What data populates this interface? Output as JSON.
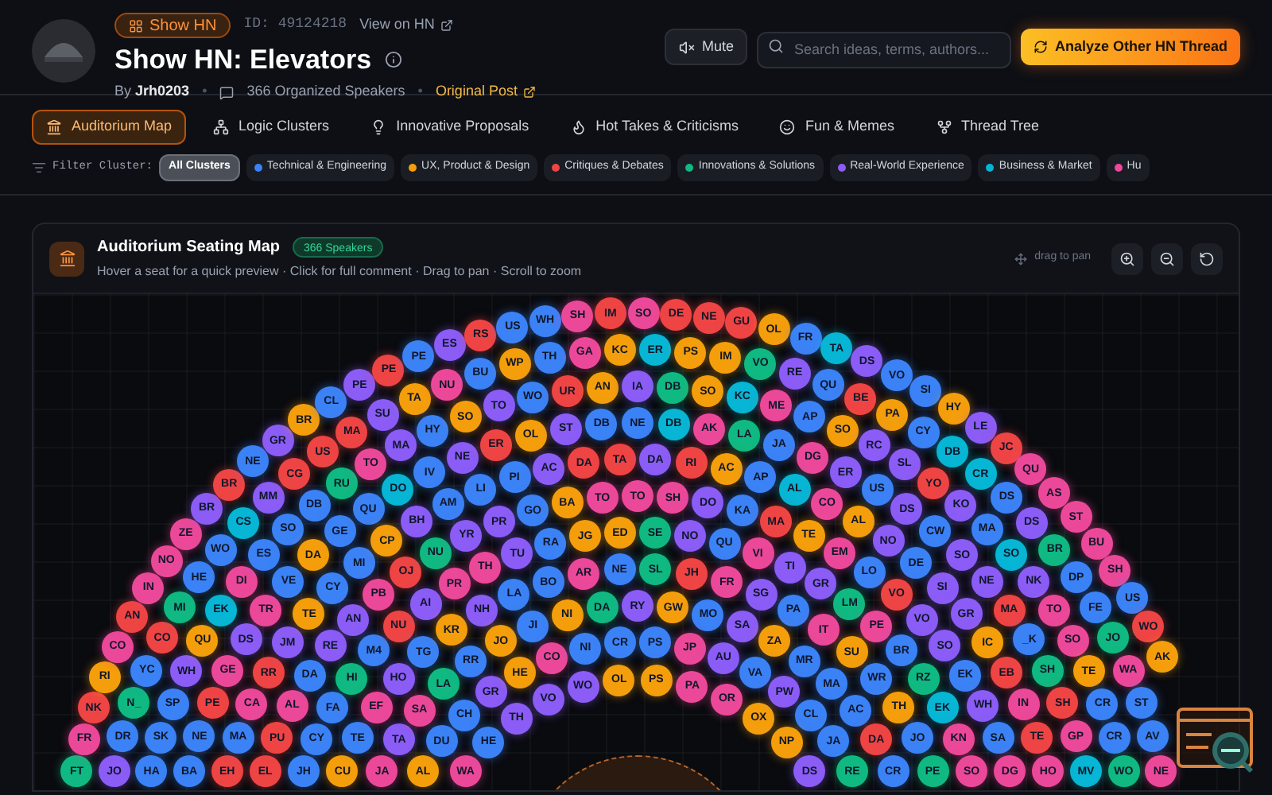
{
  "header": {
    "badge": "Show HN",
    "id": "ID: 49124218",
    "view_link": "View on HN",
    "title": "Show HN: Elevators",
    "by": "By",
    "author": "Jrh0203",
    "speakers": "366 Organized Speakers",
    "original_post": "Original Post",
    "separators": [
      "•",
      "•"
    ]
  },
  "mute_button": "Mute",
  "search": {
    "placeholder": "Search ideas, terms, authors..."
  },
  "analyze_button": "Analyze Other HN Thread",
  "tabs": [
    {
      "label": "Auditorium Map",
      "kind": "map",
      "selected": true
    },
    {
      "label": "Logic Clusters",
      "kind": "clusters",
      "selected": false
    },
    {
      "label": "Innovative Proposals",
      "kind": "ideas",
      "selected": false
    },
    {
      "label": "Hot Takes & Criticisms",
      "kind": "hot",
      "selected": false
    },
    {
      "label": "Fun & Memes",
      "kind": "fun",
      "selected": false
    },
    {
      "label": "Thread Tree",
      "kind": "tree",
      "selected": false
    }
  ],
  "filter": {
    "label": "Filter Cluster:",
    "chips": [
      {
        "label": "All Clusters",
        "selected": true
      },
      {
        "label": "Technical & Engineering",
        "color": "#3b82f6",
        "selected": false
      },
      {
        "label": "UX, Product & Design",
        "color": "#f59e0b",
        "selected": false
      },
      {
        "label": "Critiques & Debates",
        "color": "#ef4444",
        "selected": false
      },
      {
        "label": "Innovations & Solutions",
        "color": "#10b981",
        "selected": false
      },
      {
        "label": "Real-World Experience",
        "color": "#8b5cf6",
        "selected": false
      },
      {
        "label": "Business & Market",
        "color": "#06b6d4",
        "selected": false
      },
      {
        "label": "Hu",
        "color": "#ec4899",
        "selected": false
      }
    ]
  },
  "map": {
    "title": "Auditorium Seating Map",
    "badge": "366 Speakers",
    "subtitle": "Hover a seat for a quick preview · Click for full comment · Drag to pan · Scroll to zoom",
    "pan_hint": "drag to pan",
    "rings": [
      {
        "seats": [
          {
            "label": "FT",
            "color": "#10b981"
          },
          {
            "label": "FR",
            "color": "#ec4899"
          },
          {
            "label": "NK",
            "color": "#ef4444"
          },
          {
            "label": "RI",
            "color": "#f59e0b"
          },
          {
            "label": "CO",
            "color": "#ec4899"
          },
          {
            "label": "AN",
            "color": "#ef4444"
          },
          {
            "label": "IN",
            "color": "#ec4899"
          },
          {
            "label": "NO",
            "color": "#ec4899"
          },
          {
            "label": "ZE",
            "color": "#ec4899"
          },
          {
            "label": "BR",
            "color": "#8b5cf6"
          },
          {
            "label": "BR",
            "color": "#ef4444"
          },
          {
            "label": "NE",
            "color": "#3b82f6"
          },
          {
            "label": "GR",
            "color": "#8b5cf6"
          },
          {
            "label": "BR",
            "color": "#f59e0b"
          },
          {
            "label": "CL",
            "color": "#3b82f6"
          },
          {
            "label": "PE",
            "color": "#8b5cf6"
          },
          {
            "label": "PE",
            "color": "#ef4444"
          },
          {
            "label": "PE",
            "color": "#3b82f6"
          },
          {
            "label": "ES",
            "color": "#8b5cf6"
          },
          {
            "label": "RS",
            "color": "#ef4444"
          },
          {
            "label": "US",
            "color": "#3b82f6"
          },
          {
            "label": "WH",
            "color": "#3b82f6"
          },
          {
            "label": "SH",
            "color": "#ec4899"
          },
          {
            "label": "IM",
            "color": "#ef4444"
          },
          {
            "label": "SO",
            "color": "#ec4899"
          },
          {
            "label": "DE",
            "color": "#ef4444"
          },
          {
            "label": "NE",
            "color": "#ef4444"
          },
          {
            "label": "GU",
            "color": "#ef4444"
          },
          {
            "label": "OL",
            "color": "#f59e0b"
          },
          {
            "label": "FR",
            "color": "#3b82f6"
          },
          {
            "label": "TA",
            "color": "#06b6d4"
          },
          {
            "label": "DS",
            "color": "#8b5cf6"
          },
          {
            "label": "VO",
            "color": "#3b82f6"
          },
          {
            "label": "SI",
            "color": "#3b82f6"
          },
          {
            "label": "HY",
            "color": "#f59e0b"
          },
          {
            "label": "LE",
            "color": "#8b5cf6"
          },
          {
            "label": "JC",
            "color": "#ef4444"
          },
          {
            "label": "QU",
            "color": "#ec4899"
          },
          {
            "label": "AS",
            "color": "#ec4899"
          },
          {
            "label": "ST",
            "color": "#ec4899"
          },
          {
            "label": "BU",
            "color": "#ec4899"
          },
          {
            "label": "SH",
            "color": "#ec4899"
          },
          {
            "label": "US",
            "color": "#3b82f6"
          },
          {
            "label": "WO",
            "color": "#ef4444"
          },
          {
            "label": "AK",
            "color": "#f59e0b"
          }
        ]
      },
      {
        "seats": [
          {
            "label": "JO",
            "color": "#8b5cf6"
          },
          {
            "label": "DR",
            "color": "#3b82f6"
          },
          {
            "label": "N_",
            "color": "#10b981"
          },
          {
            "label": "YC",
            "color": "#3b82f6"
          },
          {
            "label": "CO",
            "color": "#ef4444"
          },
          {
            "label": "MI",
            "color": "#10b981"
          },
          {
            "label": "HE",
            "color": "#3b82f6"
          },
          {
            "label": "WO",
            "color": "#3b82f6"
          },
          {
            "label": "CS",
            "color": "#06b6d4"
          },
          {
            "label": "MM",
            "color": "#8b5cf6"
          },
          {
            "label": "CG",
            "color": "#ef4444"
          },
          {
            "label": "US",
            "color": "#ef4444"
          },
          {
            "label": "MA",
            "color": "#ef4444"
          },
          {
            "label": "SU",
            "color": "#8b5cf6"
          },
          {
            "label": "TA",
            "color": "#f59e0b"
          },
          {
            "label": "NU",
            "color": "#ec4899"
          },
          {
            "label": "BU",
            "color": "#3b82f6"
          },
          {
            "label": "WP",
            "color": "#f59e0b"
          },
          {
            "label": "TH",
            "color": "#3b82f6"
          },
          {
            "label": "GA",
            "color": "#ec4899"
          },
          {
            "label": "KC",
            "color": "#f59e0b"
          },
          {
            "label": "ER",
            "color": "#06b6d4"
          },
          {
            "label": "PS",
            "color": "#f59e0b"
          },
          {
            "label": "IM",
            "color": "#f59e0b"
          },
          {
            "label": "VO",
            "color": "#10b981"
          },
          {
            "label": "RE",
            "color": "#8b5cf6"
          },
          {
            "label": "QU",
            "color": "#3b82f6"
          },
          {
            "label": "BE",
            "color": "#ef4444"
          },
          {
            "label": "PA",
            "color": "#f59e0b"
          },
          {
            "label": "CY",
            "color": "#3b82f6"
          },
          {
            "label": "DB",
            "color": "#06b6d4"
          },
          {
            "label": "CR",
            "color": "#06b6d4"
          },
          {
            "label": "DS",
            "color": "#3b82f6"
          },
          {
            "label": "DS",
            "color": "#8b5cf6"
          },
          {
            "label": "BR",
            "color": "#10b981"
          },
          {
            "label": "DP",
            "color": "#3b82f6"
          },
          {
            "label": "FE",
            "color": "#3b82f6"
          },
          {
            "label": "JO",
            "color": "#10b981"
          },
          {
            "label": "WA",
            "color": "#ec4899"
          },
          {
            "label": "ST",
            "color": "#3b82f6"
          },
          {
            "label": "AV",
            "color": "#3b82f6"
          },
          {
            "label": "NE",
            "color": "#ec4899"
          }
        ]
      },
      {
        "seats": [
          {
            "label": "HA",
            "color": "#3b82f6"
          },
          {
            "label": "SK",
            "color": "#3b82f6"
          },
          {
            "label": "SP",
            "color": "#3b82f6"
          },
          {
            "label": "WH",
            "color": "#8b5cf6"
          },
          {
            "label": "QU",
            "color": "#f59e0b"
          },
          {
            "label": "EK",
            "color": "#06b6d4"
          },
          {
            "label": "DI",
            "color": "#ec4899"
          },
          {
            "label": "ES",
            "color": "#3b82f6"
          },
          {
            "label": "SO",
            "color": "#3b82f6"
          },
          {
            "label": "DB",
            "color": "#3b82f6"
          },
          {
            "label": "RU",
            "color": "#10b981"
          },
          {
            "label": "TO",
            "color": "#ec4899"
          },
          {
            "label": "MA",
            "color": "#8b5cf6"
          },
          {
            "label": "HY",
            "color": "#3b82f6"
          },
          {
            "label": "SO",
            "color": "#f59e0b"
          },
          {
            "label": "TO",
            "color": "#8b5cf6"
          },
          {
            "label": "WO",
            "color": "#3b82f6"
          },
          {
            "label": "UR",
            "color": "#ef4444"
          },
          {
            "label": "AN",
            "color": "#f59e0b"
          },
          {
            "label": "IA",
            "color": "#8b5cf6"
          },
          {
            "label": "DB",
            "color": "#10b981"
          },
          {
            "label": "SO",
            "color": "#f59e0b"
          },
          {
            "label": "KC",
            "color": "#06b6d4"
          },
          {
            "label": "ME",
            "color": "#ec4899"
          },
          {
            "label": "AP",
            "color": "#3b82f6"
          },
          {
            "label": "SO",
            "color": "#f59e0b"
          },
          {
            "label": "RC",
            "color": "#8b5cf6"
          },
          {
            "label": "SL",
            "color": "#8b5cf6"
          },
          {
            "label": "YO",
            "color": "#ef4444"
          },
          {
            "label": "KO",
            "color": "#8b5cf6"
          },
          {
            "label": "MA",
            "color": "#3b82f6"
          },
          {
            "label": "SO",
            "color": "#06b6d4"
          },
          {
            "label": "NK",
            "color": "#8b5cf6"
          },
          {
            "label": "TO",
            "color": "#ec4899"
          },
          {
            "label": "SO",
            "color": "#ec4899"
          },
          {
            "label": "TE",
            "color": "#f59e0b"
          },
          {
            "label": "CR",
            "color": "#3b82f6"
          },
          {
            "label": "CR",
            "color": "#3b82f6"
          },
          {
            "label": "WO",
            "color": "#10b981"
          }
        ]
      },
      {
        "seats": [
          {
            "label": "BA",
            "color": "#3b82f6"
          },
          {
            "label": "NE",
            "color": "#3b82f6"
          },
          {
            "label": "PE",
            "color": "#ef4444"
          },
          {
            "label": "GE",
            "color": "#ec4899"
          },
          {
            "label": "DS",
            "color": "#8b5cf6"
          },
          {
            "label": "TR",
            "color": "#ec4899"
          },
          {
            "label": "VE",
            "color": "#3b82f6"
          },
          {
            "label": "DA",
            "color": "#f59e0b"
          },
          {
            "label": "GE",
            "color": "#3b82f6"
          },
          {
            "label": "QU",
            "color": "#3b82f6"
          },
          {
            "label": "DO",
            "color": "#06b6d4"
          },
          {
            "label": "IV",
            "color": "#3b82f6"
          },
          {
            "label": "NE",
            "color": "#8b5cf6"
          },
          {
            "label": "ER",
            "color": "#ef4444"
          },
          {
            "label": "OL",
            "color": "#f59e0b"
          },
          {
            "label": "ST",
            "color": "#8b5cf6"
          },
          {
            "label": "DB",
            "color": "#3b82f6"
          },
          {
            "label": "NE",
            "color": "#3b82f6"
          },
          {
            "label": "DB",
            "color": "#06b6d4"
          },
          {
            "label": "AK",
            "color": "#ec4899"
          },
          {
            "label": "LA",
            "color": "#10b981"
          },
          {
            "label": "JA",
            "color": "#3b82f6"
          },
          {
            "label": "DG",
            "color": "#ec4899"
          },
          {
            "label": "ER",
            "color": "#8b5cf6"
          },
          {
            "label": "US",
            "color": "#3b82f6"
          },
          {
            "label": "DS",
            "color": "#8b5cf6"
          },
          {
            "label": "CW",
            "color": "#3b82f6"
          },
          {
            "label": "SO",
            "color": "#8b5cf6"
          },
          {
            "label": "NE",
            "color": "#8b5cf6"
          },
          {
            "label": "MA",
            "color": "#ef4444"
          },
          {
            "label": "_K",
            "color": "#3b82f6"
          },
          {
            "label": "SH",
            "color": "#10b981"
          },
          {
            "label": "SH",
            "color": "#ef4444"
          },
          {
            "label": "GP",
            "color": "#ec4899"
          },
          {
            "label": "MV",
            "color": "#06b6d4"
          }
        ]
      },
      {
        "seats": [
          {
            "label": "EH",
            "color": "#ef4444"
          },
          {
            "label": "MA",
            "color": "#3b82f6"
          },
          {
            "label": "CA",
            "color": "#ec4899"
          },
          {
            "label": "RR",
            "color": "#ef4444"
          },
          {
            "label": "JM",
            "color": "#8b5cf6"
          },
          {
            "label": "TE",
            "color": "#f59e0b"
          },
          {
            "label": "CY",
            "color": "#3b82f6"
          },
          {
            "label": "MI",
            "color": "#3b82f6"
          },
          {
            "label": "CP",
            "color": "#f59e0b"
          },
          {
            "label": "BH",
            "color": "#8b5cf6"
          },
          {
            "label": "AM",
            "color": "#3b82f6"
          },
          {
            "label": "LI",
            "color": "#3b82f6"
          },
          {
            "label": "PI",
            "color": "#3b82f6"
          },
          {
            "label": "AC",
            "color": "#8b5cf6"
          },
          {
            "label": "DA",
            "color": "#ef4444"
          },
          {
            "label": "TA",
            "color": "#ef4444"
          },
          {
            "label": "DA",
            "color": "#8b5cf6"
          },
          {
            "label": "RI",
            "color": "#ef4444"
          },
          {
            "label": "AC",
            "color": "#f59e0b"
          },
          {
            "label": "AP",
            "color": "#3b82f6"
          },
          {
            "label": "AL",
            "color": "#06b6d4"
          },
          {
            "label": "CO",
            "color": "#ec4899"
          },
          {
            "label": "AL",
            "color": "#f59e0b"
          },
          {
            "label": "NO",
            "color": "#8b5cf6"
          },
          {
            "label": "DE",
            "color": "#3b82f6"
          },
          {
            "label": "SI",
            "color": "#8b5cf6"
          },
          {
            "label": "GR",
            "color": "#8b5cf6"
          },
          {
            "label": "IC",
            "color": "#f59e0b"
          },
          {
            "label": "EB",
            "color": "#ef4444"
          },
          {
            "label": "IN",
            "color": "#ec4899"
          },
          {
            "label": "TE",
            "color": "#ef4444"
          },
          {
            "label": "HO",
            "color": "#ec4899"
          }
        ]
      },
      {
        "seats": [
          {
            "label": "EL",
            "color": "#ef4444"
          },
          {
            "label": "PU",
            "color": "#ef4444"
          },
          {
            "label": "AL",
            "color": "#ec4899"
          },
          {
            "label": "DA",
            "color": "#3b82f6"
          },
          {
            "label": "RE",
            "color": "#8b5cf6"
          },
          {
            "label": "AN",
            "color": "#8b5cf6"
          },
          {
            "label": "PB",
            "color": "#ec4899"
          },
          {
            "label": "OJ",
            "color": "#ef4444"
          },
          {
            "label": "NU",
            "color": "#10b981"
          },
          {
            "label": "YR",
            "color": "#8b5cf6"
          },
          {
            "label": "PR",
            "color": "#8b5cf6"
          },
          {
            "label": "GO",
            "color": "#3b82f6"
          },
          {
            "label": "BA",
            "color": "#f59e0b"
          },
          {
            "label": "TO",
            "color": "#ec4899"
          },
          {
            "label": "TO",
            "color": "#ec4899"
          },
          {
            "label": "SH",
            "color": "#ec4899"
          },
          {
            "label": "DO",
            "color": "#8b5cf6"
          },
          {
            "label": "KA",
            "color": "#3b82f6"
          },
          {
            "label": "MA",
            "color": "#ef4444"
          },
          {
            "label": "TE",
            "color": "#f59e0b"
          },
          {
            "label": "EM",
            "color": "#ec4899"
          },
          {
            "label": "LO",
            "color": "#3b82f6"
          },
          {
            "label": "VO",
            "color": "#ef4444"
          },
          {
            "label": "VO",
            "color": "#8b5cf6"
          },
          {
            "label": "SO",
            "color": "#8b5cf6"
          },
          {
            "label": "EK",
            "color": "#3b82f6"
          },
          {
            "label": "WH",
            "color": "#8b5cf6"
          },
          {
            "label": "SA",
            "color": "#3b82f6"
          },
          {
            "label": "DG",
            "color": "#ec4899"
          }
        ]
      },
      {
        "seats": [
          {
            "label": "JH",
            "color": "#3b82f6"
          },
          {
            "label": "CY",
            "color": "#3b82f6"
          },
          {
            "label": "FA",
            "color": "#3b82f6"
          },
          {
            "label": "HI",
            "color": "#10b981"
          },
          {
            "label": "M4",
            "color": "#3b82f6"
          },
          {
            "label": "NU",
            "color": "#ef4444"
          },
          {
            "label": "AI",
            "color": "#8b5cf6"
          },
          {
            "label": "PR",
            "color": "#ec4899"
          },
          {
            "label": "TH",
            "color": "#ec4899"
          },
          {
            "label": "TU",
            "color": "#8b5cf6"
          },
          {
            "label": "RA",
            "color": "#3b82f6"
          },
          {
            "label": "JG",
            "color": "#f59e0b"
          },
          {
            "label": "ED",
            "color": "#f59e0b"
          },
          {
            "label": "SE",
            "color": "#10b981"
          },
          {
            "label": "NO",
            "color": "#8b5cf6"
          },
          {
            "label": "QU",
            "color": "#3b82f6"
          },
          {
            "label": "VI",
            "color": "#ec4899"
          },
          {
            "label": "TI",
            "color": "#8b5cf6"
          },
          {
            "label": "GR",
            "color": "#8b5cf6"
          },
          {
            "label": "LM",
            "color": "#10b981"
          },
          {
            "label": "PE",
            "color": "#ec4899"
          },
          {
            "label": "BR",
            "color": "#3b82f6"
          },
          {
            "label": "RZ",
            "color": "#10b981"
          },
          {
            "label": "EK",
            "color": "#06b6d4"
          },
          {
            "label": "KN",
            "color": "#ec4899"
          },
          {
            "label": "SO",
            "color": "#ec4899"
          }
        ]
      },
      {
        "seats": [
          {
            "label": "CU",
            "color": "#f59e0b"
          },
          {
            "label": "TE",
            "color": "#3b82f6"
          },
          {
            "label": "EF",
            "color": "#ec4899"
          },
          {
            "label": "HO",
            "color": "#8b5cf6"
          },
          {
            "label": "TG",
            "color": "#3b82f6"
          },
          {
            "label": "KR",
            "color": "#f59e0b"
          },
          {
            "label": "NH",
            "color": "#8b5cf6"
          },
          {
            "label": "LA",
            "color": "#3b82f6"
          },
          {
            "label": "BO",
            "color": "#3b82f6"
          },
          {
            "label": "AR",
            "color": "#ec4899"
          },
          {
            "label": "NE",
            "color": "#3b82f6"
          },
          {
            "label": "SL",
            "color": "#10b981"
          },
          {
            "label": "JH",
            "color": "#ef4444"
          },
          {
            "label": "FR",
            "color": "#ec4899"
          },
          {
            "label": "SG",
            "color": "#8b5cf6"
          },
          {
            "label": "PA",
            "color": "#3b82f6"
          },
          {
            "label": "IT",
            "color": "#ec4899"
          },
          {
            "label": "SU",
            "color": "#f59e0b"
          },
          {
            "label": "WR",
            "color": "#3b82f6"
          },
          {
            "label": "TH",
            "color": "#f59e0b"
          },
          {
            "label": "JO",
            "color": "#3b82f6"
          },
          {
            "label": "PE",
            "color": "#10b981"
          }
        ]
      },
      {
        "seats": [
          {
            "label": "JA",
            "color": "#ec4899"
          },
          {
            "label": "TA",
            "color": "#8b5cf6"
          },
          {
            "label": "SA",
            "color": "#ec4899"
          },
          {
            "label": "LA",
            "color": "#10b981"
          },
          {
            "label": "RR",
            "color": "#3b82f6"
          },
          {
            "label": "JO",
            "color": "#f59e0b"
          },
          {
            "label": "JI",
            "color": "#3b82f6"
          },
          {
            "label": "NI",
            "color": "#f59e0b"
          },
          {
            "label": "DA",
            "color": "#10b981"
          },
          {
            "label": "RY",
            "color": "#8b5cf6"
          },
          {
            "label": "GW",
            "color": "#f59e0b"
          },
          {
            "label": "MO",
            "color": "#3b82f6"
          },
          {
            "label": "SA",
            "color": "#8b5cf6"
          },
          {
            "label": "ZA",
            "color": "#f59e0b"
          },
          {
            "label": "MR",
            "color": "#3b82f6"
          },
          {
            "label": "MA",
            "color": "#3b82f6"
          },
          {
            "label": "AC",
            "color": "#3b82f6"
          },
          {
            "label": "DA",
            "color": "#ef4444"
          },
          {
            "label": "CR",
            "color": "#3b82f6"
          }
        ]
      },
      {
        "seats": [
          {
            "label": "AL",
            "color": "#f59e0b"
          },
          {
            "label": "DU",
            "color": "#3b82f6"
          },
          {
            "label": "CH",
            "color": "#3b82f6"
          },
          {
            "label": "GR",
            "color": "#8b5cf6"
          },
          {
            "label": "HE",
            "color": "#f59e0b"
          },
          {
            "label": "CO",
            "color": "#ec4899"
          },
          {
            "label": "NI",
            "color": "#3b82f6"
          },
          {
            "label": "CR",
            "color": "#3b82f6"
          },
          {
            "label": "PS",
            "color": "#3b82f6"
          },
          {
            "label": "JP",
            "color": "#ec4899"
          },
          {
            "label": "AU",
            "color": "#8b5cf6"
          },
          {
            "label": "VA",
            "color": "#3b82f6"
          },
          {
            "label": "PW",
            "color": "#8b5cf6"
          },
          {
            "label": "CL",
            "color": "#3b82f6"
          },
          {
            "label": "JA",
            "color": "#3b82f6"
          },
          {
            "label": "RE",
            "color": "#10b981"
          }
        ]
      },
      {
        "seats": [
          {
            "label": "WA",
            "color": "#ec4899"
          },
          {
            "label": "HE",
            "color": "#3b82f6"
          },
          {
            "label": "TH",
            "color": "#8b5cf6"
          },
          {
            "label": "VO",
            "color": "#8b5cf6"
          },
          {
            "label": "WO",
            "color": "#8b5cf6"
          },
          {
            "label": "OL",
            "color": "#f59e0b"
          },
          {
            "label": "PS",
            "color": "#f59e0b"
          },
          {
            "label": "PA",
            "color": "#ec4899"
          },
          {
            "label": "OR",
            "color": "#ec4899"
          },
          {
            "label": "OX",
            "color": "#f59e0b"
          },
          {
            "label": "NP",
            "color": "#f59e0b"
          },
          {
            "label": "DS",
            "color": "#8b5cf6"
          }
        ]
      }
    ]
  }
}
